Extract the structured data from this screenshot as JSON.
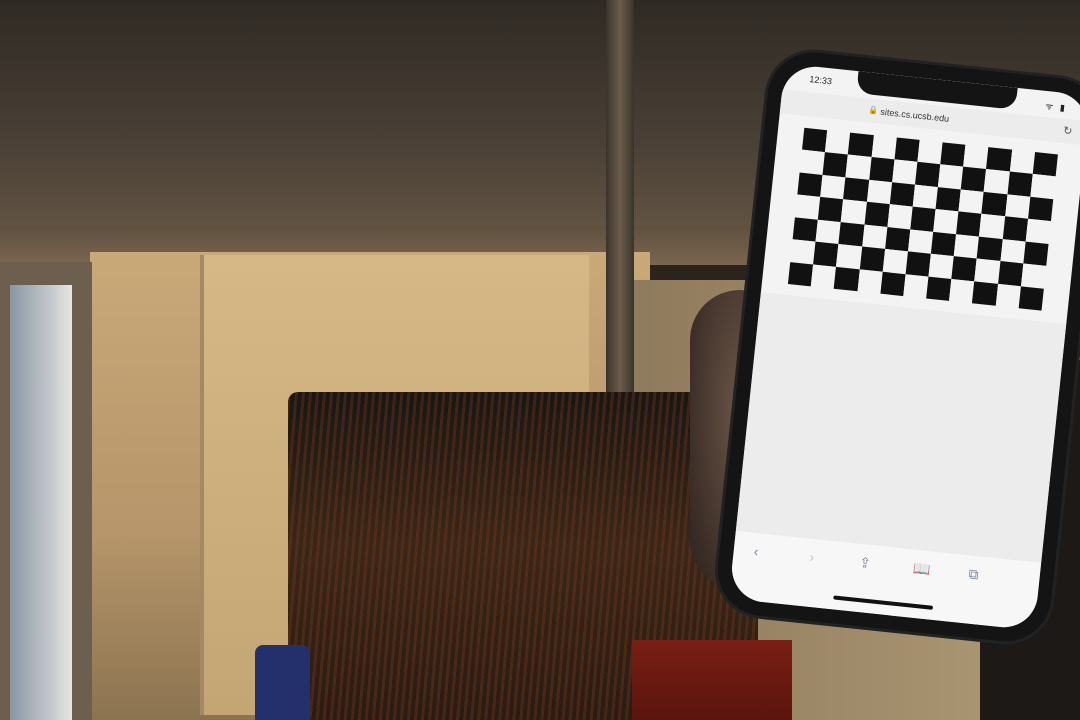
{
  "phone": {
    "status_bar": {
      "time": "12:33",
      "icons": "ᯤ ▮"
    },
    "address_bar": {
      "url": "sites.cs.ucsb.edu"
    },
    "checkerboard": {
      "rows": 7,
      "cols": 11
    },
    "toolbar": {
      "back_glyph": "‹",
      "forward_glyph": "›",
      "share_glyph": "⇪",
      "bookmarks_glyph": "📖",
      "tabs_glyph": "⧉"
    },
    "icons": [
      "lock-icon",
      "reload-icon",
      "back-icon",
      "forward-icon",
      "share-icon",
      "bookmarks-icon",
      "tabs-icon"
    ]
  }
}
